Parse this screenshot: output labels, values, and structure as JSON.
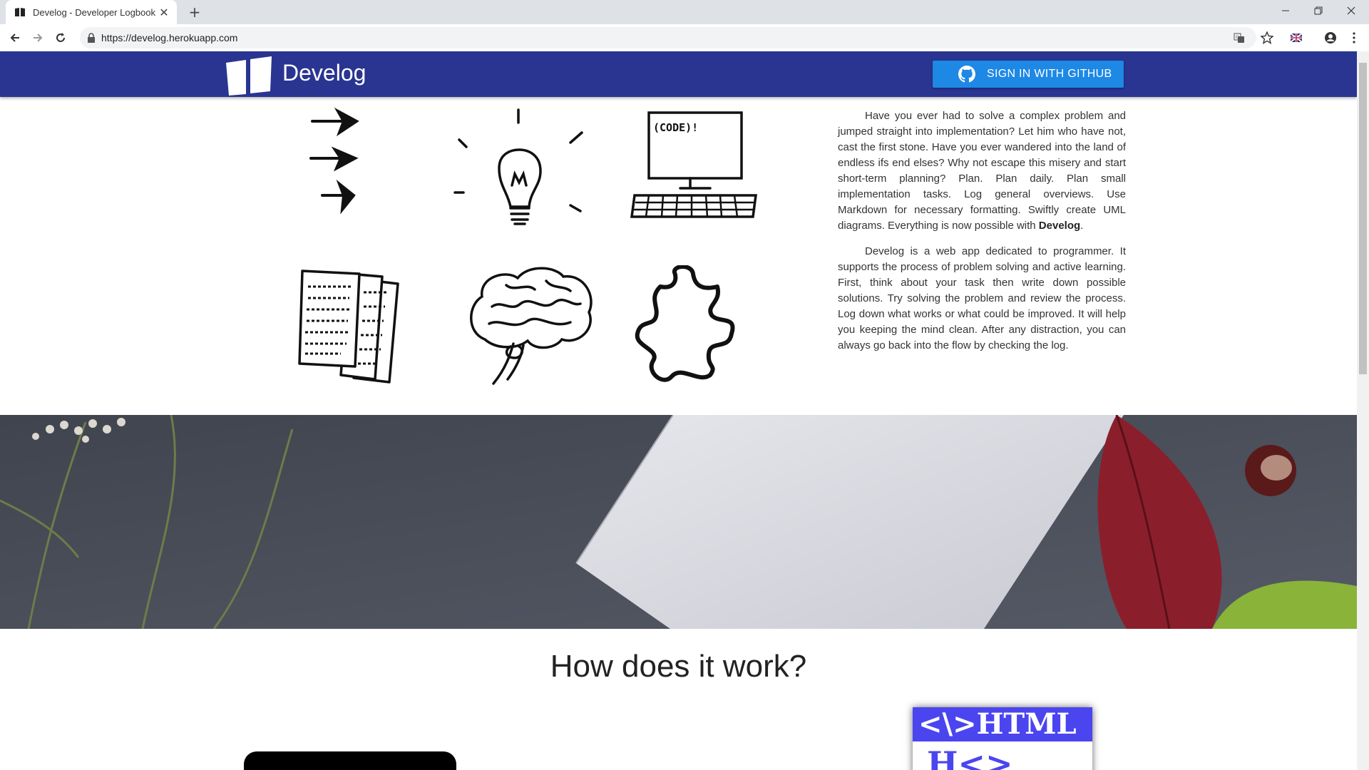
{
  "browser": {
    "tab_title": "Develog - Developer Logbook",
    "url": "https://develog.herokuapp.com",
    "new_tab_symbol": "+"
  },
  "site": {
    "brand": "Develog",
    "github_button": "SIGN IN WITH GITHUB",
    "intro_p1_before": "Have you ever had to solve a complex problem and jumped straight into implementation? Let him who have not, cast the first stone. Have you ever wandered into the land of endless ifs end elses? Why not escape this misery and start short-term planning? Plan. Plan daily. Plan small implementation tasks. Log general overviews. Use Markdown for necessary formatting. Swiftly create UML diagrams. Everything is now possible with ",
    "intro_p1_brand": "Develog",
    "intro_p1_after": ".",
    "intro_p2": "Develog is a web app dedicated to programmer. It supports the process of problem solving and active learning. First, think about your task then write down possible solutions. Try solving the problem and review the process. Log down what works or what could be improved. It will help you keeping the mind clean. After any distraction, you can always go back into the flow by checking the log.",
    "code_label": "(CODE)!",
    "how_title": "How does it work?",
    "html_card_head": "<\\>HTML",
    "html_card_body": "H<>"
  },
  "colors": {
    "nav_bg": "#293591",
    "github_button": "#1e88e5",
    "html_card": "#4b45f0"
  }
}
